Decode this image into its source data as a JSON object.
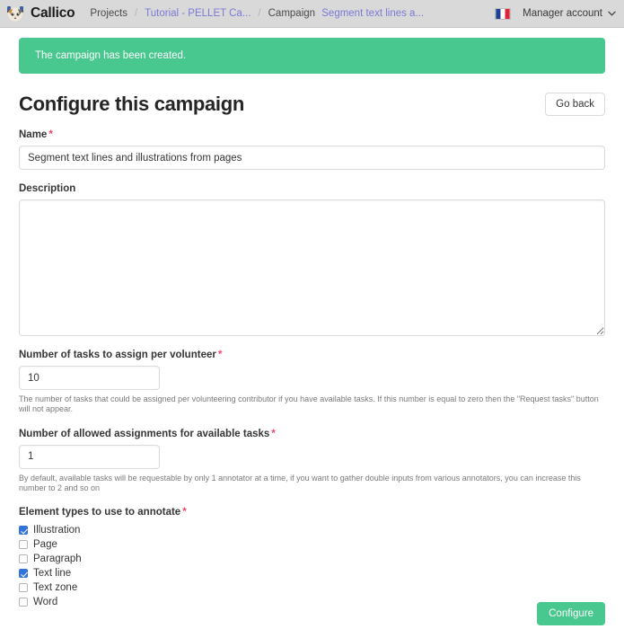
{
  "navbar": {
    "logo_icon": "callico-cat-logo-icon",
    "brand": "Callico",
    "breadcrumb": [
      {
        "label": "Projects",
        "type": "link-muted"
      },
      {
        "label": "Tutorial - PELLET Ca...",
        "type": "link"
      },
      {
        "label": "Campaign",
        "type": "text"
      },
      {
        "label": "Segment text lines a...",
        "type": "link"
      }
    ],
    "separator": "/",
    "flag_icon": "french-flag-icon",
    "account_label": "Manager account",
    "chevron_icon": "chevron-down-icon"
  },
  "notification": {
    "message": "The campaign has been created.",
    "color": "#48c78e"
  },
  "header": {
    "title": "Configure this campaign",
    "go_back_label": "Go back"
  },
  "form": {
    "name": {
      "label": "Name",
      "required_marker": "*",
      "value": "Segment text lines and illustrations from pages",
      "placeholder": ""
    },
    "description": {
      "label": "Description",
      "value": "",
      "placeholder": ""
    },
    "tasks_per_volunteer": {
      "label": "Number of tasks to assign per volunteer",
      "required_marker": "*",
      "value": "10",
      "help": "The number of tasks that could be assigned per volunteering contributor if you have available tasks. If this number is equal to zero then the \"Request tasks\" button will not appear."
    },
    "allowed_assignments": {
      "label": "Number of allowed assignments for available tasks",
      "required_marker": "*",
      "value": "1",
      "help": "By default, available tasks will be requestable by only 1 annotator at a time, if you want to gather double inputs from various annotators, you can increase this number to 2 and so on"
    },
    "element_types": {
      "label": "Element types to use to annotate",
      "required_marker": "*",
      "options": [
        {
          "label": "Illustration",
          "checked": true
        },
        {
          "label": "Page",
          "checked": false
        },
        {
          "label": "Paragraph",
          "checked": false
        },
        {
          "label": "Text line",
          "checked": true
        },
        {
          "label": "Text zone",
          "checked": false
        },
        {
          "label": "Word",
          "checked": false
        }
      ]
    }
  },
  "footer": {
    "submit_label": "Configure",
    "accent_color": "#48c78e"
  }
}
